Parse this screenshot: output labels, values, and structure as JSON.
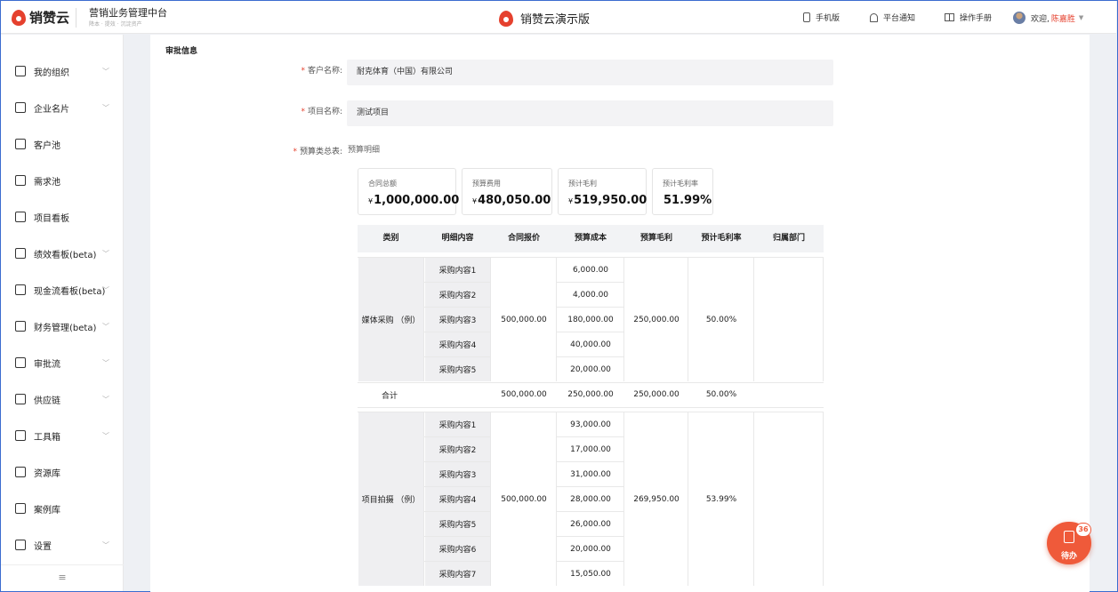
{
  "header": {
    "logo_text": "销赞云",
    "brand_title": "营销业务管理中台",
    "brand_sub": "降本 · 提效 · 沉淀资产",
    "center_title": "销赞云演示版",
    "nav": [
      {
        "label": "手机版",
        "icon": "mobile-icon"
      },
      {
        "label": "平台通知",
        "icon": "bell-icon"
      },
      {
        "label": "操作手册",
        "icon": "book-icon"
      }
    ],
    "welcome": "欢迎,",
    "user_name": "陈嘉胜"
  },
  "sidebar": {
    "items": [
      {
        "label": "我的组织",
        "icon": "org-icon",
        "chevron": true
      },
      {
        "label": "企业名片",
        "icon": "building-icon",
        "chevron": true
      },
      {
        "label": "客户池",
        "icon": "user-icon",
        "chevron": false
      },
      {
        "label": "需求池",
        "icon": "list-icon",
        "chevron": false
      },
      {
        "label": "项目看板",
        "icon": "board-icon",
        "chevron": false
      },
      {
        "label": "绩效看板(beta)",
        "icon": "chart-icon",
        "chevron": true
      },
      {
        "label": "现金流看板(beta)",
        "icon": "yen-icon",
        "chevron": true
      },
      {
        "label": "财务管理(beta)",
        "icon": "wallet-icon",
        "chevron": true
      },
      {
        "label": "审批流",
        "icon": "stamp-icon",
        "chevron": true
      },
      {
        "label": "供应链",
        "icon": "network-icon",
        "chevron": true
      },
      {
        "label": "工具箱",
        "icon": "toolbox-icon",
        "chevron": true
      },
      {
        "label": "资源库",
        "icon": "folder-icon",
        "chevron": false
      },
      {
        "label": "案例库",
        "icon": "presentation-icon",
        "chevron": false
      },
      {
        "label": "设置",
        "icon": "gear-icon",
        "chevron": true
      }
    ],
    "collapse_glyph": "≡"
  },
  "form": {
    "section_title": "审批信息",
    "customer_label": "客户名称:",
    "customer_value": "耐克体育（中国）有限公司",
    "project_label": "项目名称:",
    "project_value": "测试项目",
    "budget_label": "预算类总表:",
    "budget_link": "预算明细"
  },
  "kpis": [
    {
      "label": "合同总额",
      "currency": "¥",
      "value": "1,000,000.00"
    },
    {
      "label": "预算费用",
      "currency": "¥",
      "value": "480,050.00"
    },
    {
      "label": "预计毛利",
      "currency": "¥",
      "value": "519,950.00"
    },
    {
      "label": "预计毛利率",
      "currency": "",
      "value": "51.99%"
    }
  ],
  "table": {
    "headers": [
      "类别",
      "明细内容",
      "合同报价",
      "预算成本",
      "预算毛利",
      "预计毛利率",
      "归属部门"
    ],
    "groups": [
      {
        "category": "媒体采购 （例）",
        "quote": "500,000.00",
        "profit": "250,000.00",
        "rate": "50.00%",
        "rows": [
          {
            "item": "采购内容1",
            "cost": "6,000.00"
          },
          {
            "item": "采购内容2",
            "cost": "4,000.00"
          },
          {
            "item": "采购内容3",
            "cost": "180,000.00"
          },
          {
            "item": "采购内容4",
            "cost": "40,000.00"
          },
          {
            "item": "采购内容5",
            "cost": "20,000.00"
          }
        ],
        "subtotal": {
          "label": "合计",
          "quote": "500,000.00",
          "cost": "250,000.00",
          "profit": "250,000.00",
          "rate": "50.00%"
        }
      },
      {
        "category": "项目拍摄 （例）",
        "quote": "500,000.00",
        "profit": "269,950.00",
        "rate": "53.99%",
        "rows": [
          {
            "item": "采购内容1",
            "cost": "93,000.00"
          },
          {
            "item": "采购内容2",
            "cost": "17,000.00"
          },
          {
            "item": "采购内容3",
            "cost": "31,000.00"
          },
          {
            "item": "采购内容4",
            "cost": "28,000.00"
          },
          {
            "item": "采购内容5",
            "cost": "26,000.00"
          },
          {
            "item": "采购内容6",
            "cost": "20,000.00"
          },
          {
            "item": "采购内容7",
            "cost": "15,050.00"
          }
        ]
      }
    ]
  },
  "float_button": {
    "label": "待办",
    "badge": "36"
  }
}
